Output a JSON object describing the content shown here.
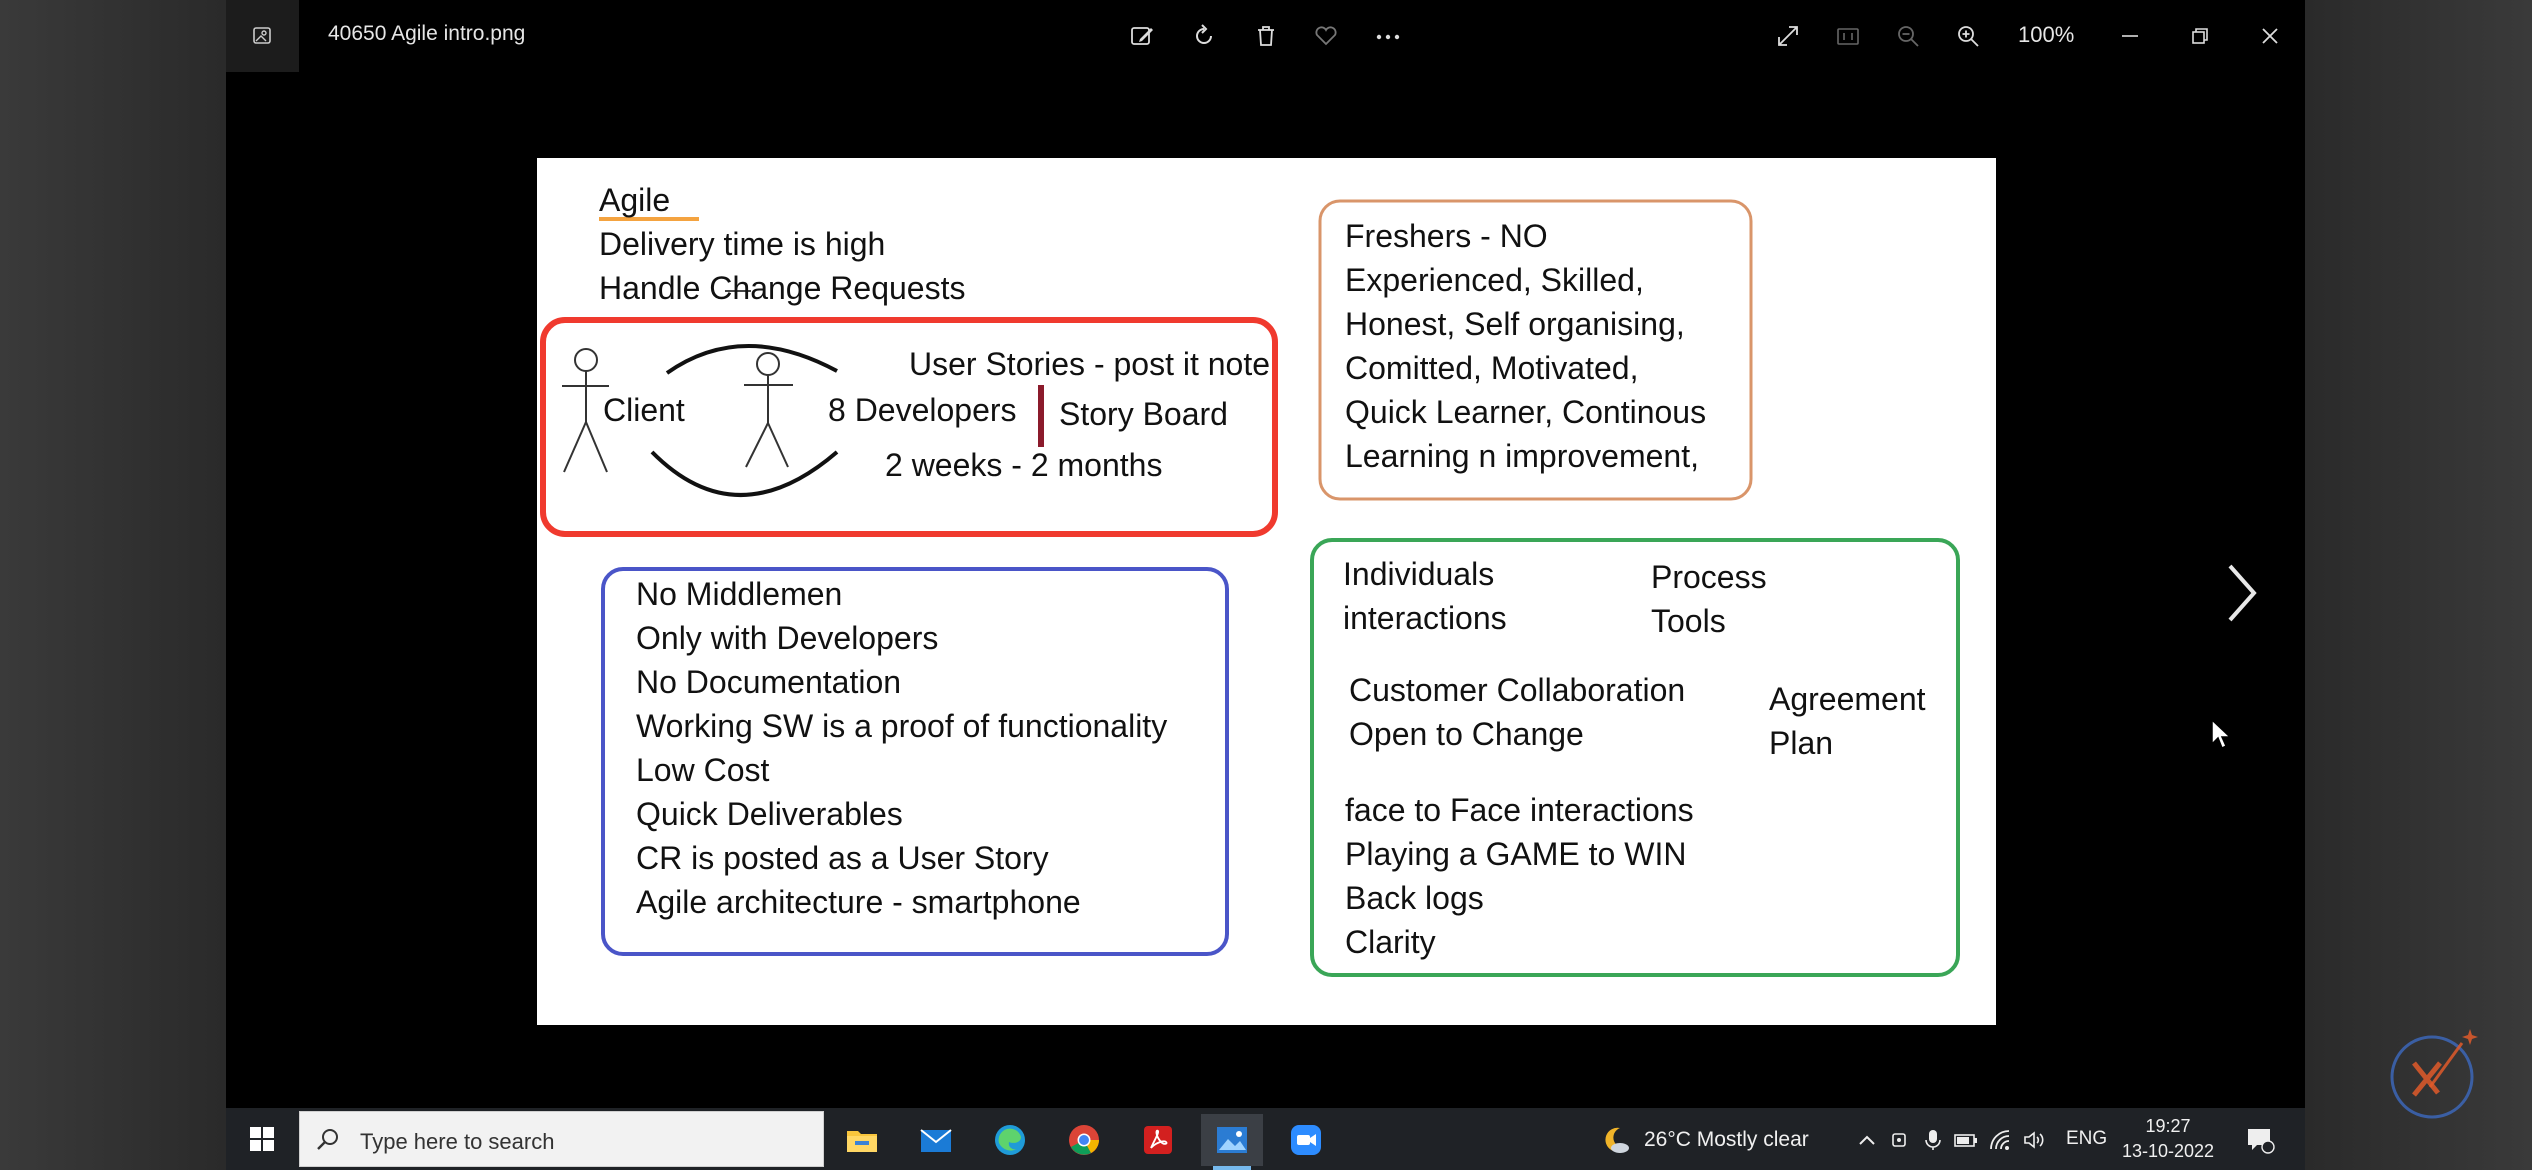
{
  "window": {
    "title": "40650 Agile intro.png",
    "zoom": "100%"
  },
  "slide": {
    "header": {
      "title": "Agile",
      "line1": "Delivery time is high",
      "line2": "Handle Change Requests"
    },
    "red_box": {
      "user_stories": "User Stories - post it note",
      "client": "Client",
      "developers": "8 Developers",
      "story_board": "Story Board",
      "duration": "2 weeks - 2 months"
    },
    "orange_box": {
      "lines": [
        "Freshers - NO",
        "Experienced, Skilled,",
        "Honest, Self organising,",
        "Comitted, Motivated,",
        "Quick Learner, Continous",
        "Learning n improvement,"
      ]
    },
    "blue_box": {
      "lines": [
        "No Middlemen",
        "Only with Developers",
        "No Documentation",
        "Working SW is a proof of functionality",
        "Low Cost",
        "Quick Deliverables",
        "CR is posted as a User Story",
        "Agile architecture - smartphone"
      ]
    },
    "green_box": {
      "individuals": "Individuals",
      "interactions": "interactions",
      "process": "Process",
      "tools": "Tools",
      "customer": "Customer Collaboration",
      "open": "Open to Change",
      "agreement": "Agreement",
      "plan": "Plan",
      "lines": [
        "face to Face interactions",
        "Playing a GAME to WIN",
        "Back logs",
        "Clarity"
      ]
    },
    "colors": {
      "red": "#f03a2e",
      "orange": "#d9956a",
      "blue": "#4a55c8",
      "green": "#3aa657",
      "underline": "#f4a340",
      "divider": "#8b1a2b"
    }
  },
  "taskbar": {
    "search_placeholder": "Type here to search",
    "weather": "26°C  Mostly clear",
    "language": "ENG",
    "time": "19:27",
    "date": "13-10-2022"
  }
}
